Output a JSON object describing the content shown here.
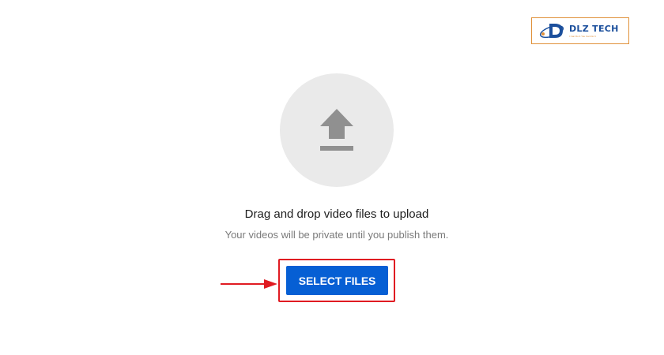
{
  "watermark": {
    "text": "DLZ TECH",
    "tagline": "I Can Do It You Can Do It",
    "border_color": "#e0913a",
    "text_color": "#1b4f9c"
  },
  "upload": {
    "icon": "upload-arrow-icon",
    "circle_color": "#eaeaea",
    "icon_color": "#909090",
    "title": "Drag and drop video files to upload",
    "subtitle": "Your videos will be private until you publish them."
  },
  "select_button": {
    "label": "SELECT FILES",
    "color": "#065fd4"
  },
  "annotation": {
    "highlight_color": "#e01b22",
    "arrow_icon": "red-arrow-right-icon"
  }
}
